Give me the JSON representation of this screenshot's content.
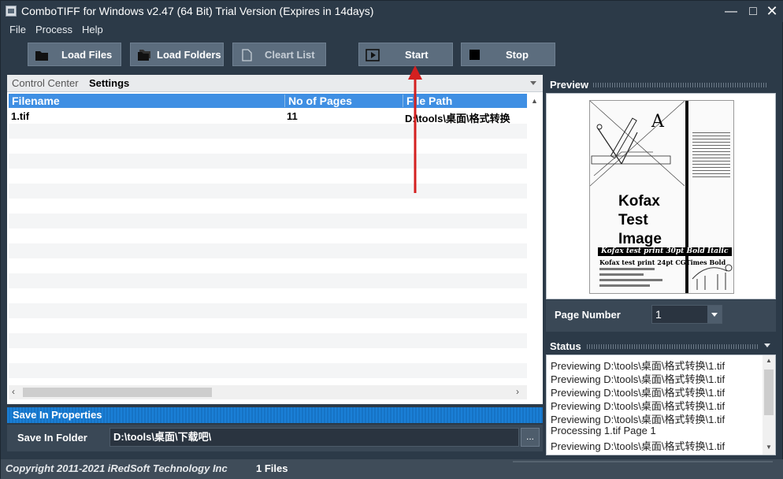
{
  "window": {
    "title": "ComboTIFF for Windows v2.47 (64 Bit)  Trial Version (Expires in 14days)",
    "minimize": "—",
    "maximize": "□",
    "close": "✕"
  },
  "menu": [
    "File",
    "Process",
    "Help"
  ],
  "toolbar": {
    "load_files": "Load Files",
    "load_folders": "Load Folders",
    "clear_list": "Cleart List",
    "start": "Start",
    "stop": "Stop"
  },
  "tabs": {
    "control_center": "Control Center",
    "settings": "Settings"
  },
  "file_list": {
    "columns": [
      "Filename",
      "No of Pages",
      "File Path"
    ],
    "rows": [
      {
        "filename": "1.tif",
        "pages": "11",
        "path": "D:\\tools\\桌面\\格式转换"
      }
    ]
  },
  "save_in": {
    "header": "Save In Properties",
    "folder_label": "Save In Folder",
    "folder_value": "D:\\tools\\桌面\\下载吧\\",
    "browse": "..."
  },
  "preview": {
    "header": "Preview",
    "doc_letter": "A",
    "doc_title_lines": [
      "Kofax",
      "Test",
      "Image"
    ],
    "doc_line_1": "Kofax test print 30pt Bold Italic",
    "doc_line_2": "Kofax test print 24pt CGTimes Bold",
    "page_number_label": "Page Number",
    "page_number_value": "1"
  },
  "status": {
    "header": "Status",
    "lines": [
      "Previewing D:\\tools\\桌面\\格式转换\\1.tif",
      "Previewing D:\\tools\\桌面\\格式转换\\1.tif",
      "Previewing D:\\tools\\桌面\\格式转换\\1.tif",
      "Previewing D:\\tools\\桌面\\格式转换\\1.tif",
      "Previewing D:\\tools\\桌面\\格式转换\\1.tif",
      "Processing 1.tif Page 1",
      "Previewing D:\\tools\\桌面\\格式转换\\1.tif"
    ]
  },
  "statusbar": {
    "copyright": "Copyright 2011-2021 iRedSoft Technology Inc",
    "files_count": "1 Files"
  },
  "colors": {
    "window_bg": "#2c3a48",
    "header_blue": "#3f8fe3",
    "annotation_red": "#d42020"
  }
}
